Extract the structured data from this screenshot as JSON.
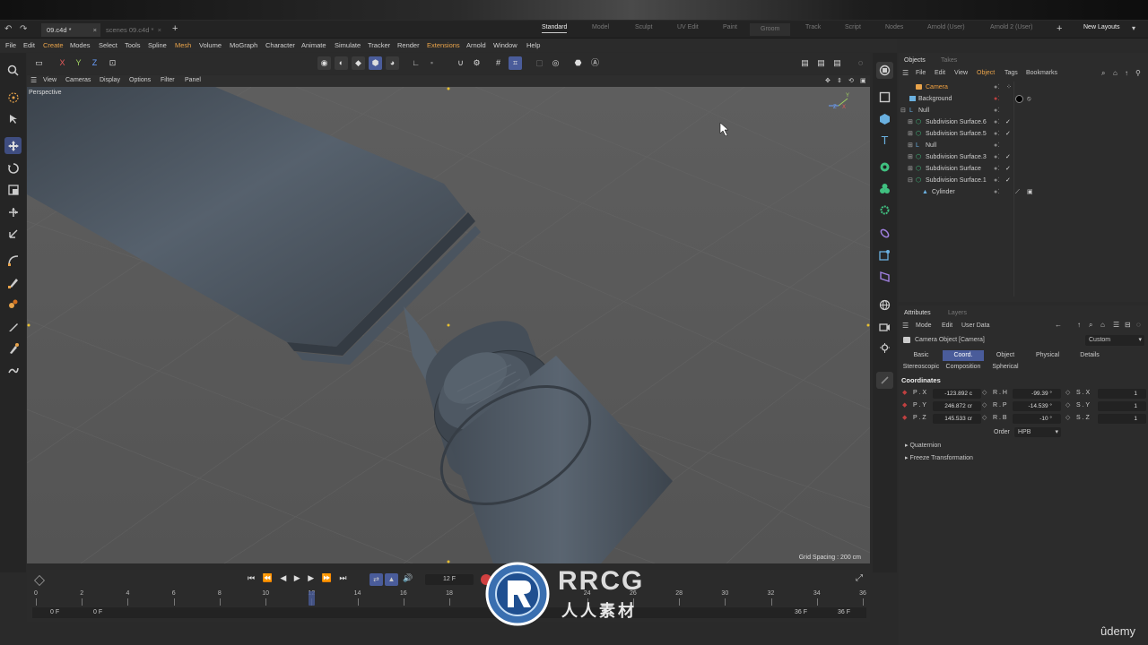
{
  "doc_tabs": [
    {
      "label": "09.c4d *"
    },
    {
      "label": "scenes 09.c4d *"
    }
  ],
  "new_doc_symbol": "+",
  "layout_tabs": [
    {
      "label": "Standard",
      "active": true
    },
    {
      "label": "Model"
    },
    {
      "label": "Sculpt"
    },
    {
      "label": "UV Edit"
    },
    {
      "label": "Paint"
    },
    {
      "label": "Groom"
    },
    {
      "label": "Track"
    },
    {
      "label": "Script"
    },
    {
      "label": "Nodes"
    },
    {
      "label": "Arnold (User)"
    },
    {
      "label": "Arnold 2 (User)"
    }
  ],
  "new_layouts": "New Layouts",
  "menu": [
    "File",
    "Edit",
    "Create",
    "Modes",
    "Select",
    "Tools",
    "Spline",
    "Mesh",
    "Volume",
    "MoGraph",
    "Character",
    "Animate",
    "Simulate",
    "Tracker",
    "Render",
    "Extensions",
    "Arnold",
    "Window",
    "Help"
  ],
  "menu_highlight": [
    "Create",
    "Mesh",
    "Extensions"
  ],
  "axis_buttons": {
    "x": "X",
    "y": "Y",
    "z": "Z"
  },
  "viewport_menu": [
    "View",
    "Cameras",
    "Display",
    "Options",
    "Filter",
    "Panel"
  ],
  "viewport": {
    "label": "Perspective",
    "grid_spacing": "Grid Spacing : 200 cm",
    "axis_labels": {
      "z": "Z",
      "x": "X",
      "y": "Y"
    }
  },
  "timeline": {
    "current_frame": "12 F",
    "ticks": [
      "0",
      "2",
      "4",
      "6",
      "8",
      "10",
      "12",
      "14",
      "16",
      "18",
      "20",
      "22",
      "24",
      "26",
      "28",
      "30",
      "32",
      "34",
      "36"
    ],
    "playhead_frame": 12,
    "start_frame": "0 F",
    "min_frame": "0 F",
    "max_frame": "36 F",
    "end_frame": "36 F"
  },
  "objects_panel": {
    "tabs": [
      "Objects",
      "Takes"
    ],
    "menu": [
      "File",
      "Edit",
      "View",
      "Object",
      "Tags",
      "Bookmarks"
    ],
    "items": [
      {
        "name": "Camera",
        "indent": 0,
        "icon": "camera-icon",
        "check": false,
        "camera": true
      },
      {
        "name": "Background",
        "indent": 0,
        "icon": "background-icon",
        "check": false
      },
      {
        "name": "Null",
        "indent": 0,
        "icon": "null-icon",
        "check": false
      },
      {
        "name": "Subdivision Surface.6",
        "indent": 1,
        "icon": "subdivision-icon",
        "check": true
      },
      {
        "name": "Subdivision Surface.5",
        "indent": 1,
        "icon": "subdivision-icon",
        "check": true
      },
      {
        "name": "Null",
        "indent": 1,
        "icon": "null-icon",
        "check": false
      },
      {
        "name": "Subdivision Surface.3",
        "indent": 1,
        "icon": "subdivision-icon",
        "check": true
      },
      {
        "name": "Subdivision Surface",
        "indent": 1,
        "icon": "subdivision-icon",
        "check": true
      },
      {
        "name": "Subdivision Surface.1",
        "indent": 1,
        "icon": "subdivision-icon",
        "check": true
      },
      {
        "name": "Cylinder",
        "indent": 2,
        "icon": "cylinder-icon",
        "check": false
      }
    ]
  },
  "attributes_panel": {
    "tabs": [
      "Attributes",
      "Layers"
    ],
    "menu": [
      "Mode",
      "Edit",
      "User Data"
    ],
    "object_title": "Camera Object [Camera]",
    "preset": "Custom",
    "tab_row1": [
      "Basic",
      "Coord.",
      "Object",
      "Physical",
      "Details"
    ],
    "tab_row2": [
      "Stereoscopic",
      "Composition",
      "Spherical"
    ],
    "selected_tab": "Coord.",
    "section": "Coordinates",
    "coords": [
      {
        "p_label": "P . X",
        "p_val": "-123.892 c",
        "r_label": "R . H",
        "r_val": "-99.39 °",
        "s_label": "S . X",
        "s_val": "1"
      },
      {
        "p_label": "P . Y",
        "p_val": "246.872 cr",
        "r_label": "R . P",
        "r_val": "-14.539 °",
        "s_label": "S . Y",
        "s_val": "1"
      },
      {
        "p_label": "P . Z",
        "p_val": "145.533 cr",
        "r_label": "R . B",
        "r_val": "-10 °",
        "s_label": "S . Z",
        "s_val": "1"
      }
    ],
    "order_label": "Order",
    "order_value": "HPB",
    "collapsibles": [
      "Quaternion",
      "Freeze Transformation"
    ]
  },
  "watermark": {
    "brand": "RRCG",
    "sub": "人人素材",
    "corner": "ûdemy"
  },
  "colors": {
    "accent": "#4a5c9a",
    "camera_text": "#f0a040",
    "menu_highlight": "#e8a34a",
    "model": "#4a5562"
  }
}
